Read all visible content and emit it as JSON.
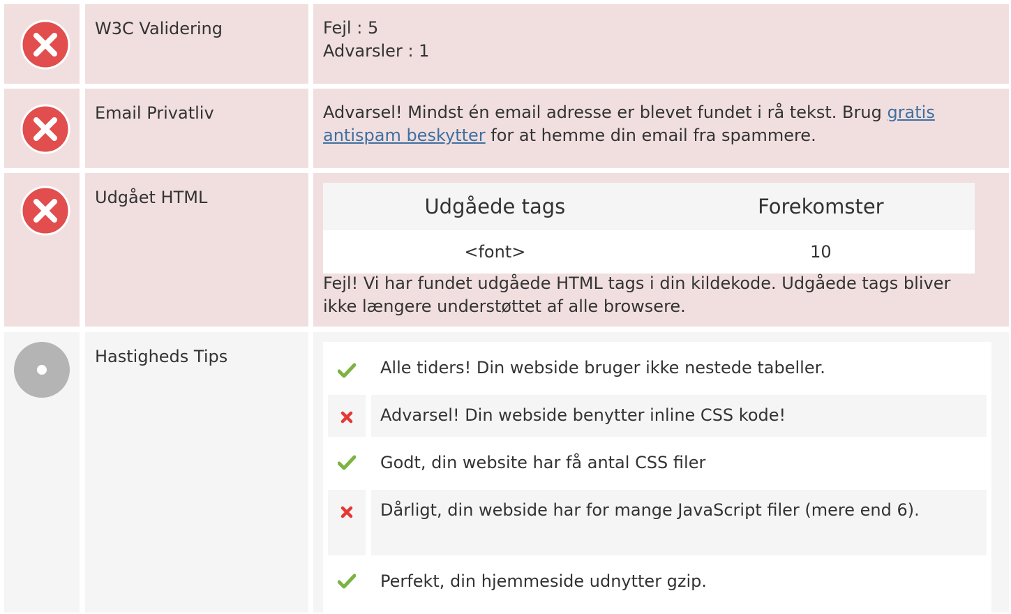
{
  "rows": {
    "w3c": {
      "label": "W3C Validering",
      "errors": "Fejl : 5",
      "warnings": "Advarsler : 1"
    },
    "email": {
      "label": "Email Privatliv",
      "text_before": "Advarsel! Mindst én email adresse er blevet fundet i rå tekst. Brug ",
      "link": "gratis antispam beskytter",
      "text_after": " for at hemme din email fra spammere."
    },
    "html": {
      "label": "Udgået HTML",
      "col_tags": "Udgåede tags",
      "col_count": "Forekomster",
      "rows": [
        {
          "tag": "<font>",
          "count": "10"
        }
      ],
      "note": "Fejl! Vi har fundet udgåede HTML tags i din kildekode. Udgåede tags bliver ikke længere understøttet af alle browsere."
    },
    "speed": {
      "label": "Hastigheds Tips",
      "tips": [
        {
          "status": "ok",
          "text": "Alle tiders! Din webside bruger ikke nestede tabeller."
        },
        {
          "status": "bad",
          "text": "Advarsel! Din webside benytter inline CSS kode!"
        },
        {
          "status": "ok",
          "text": "Godt, din website har få antal CSS filer"
        },
        {
          "status": "bad",
          "text": "Dårligt, din webside har for mange JavaScript filer (mere end 6)."
        },
        {
          "status": "ok",
          "text": "Perfekt, din hjemmeside udnytter gzip."
        }
      ]
    }
  },
  "colors": {
    "error_bg": "#f1dfe0",
    "neutral_bg": "#f5f5f5",
    "ok": "#7cb342",
    "bad": "#e53935",
    "error_icon": "#e24d4d",
    "link": "#3f6f9f"
  }
}
